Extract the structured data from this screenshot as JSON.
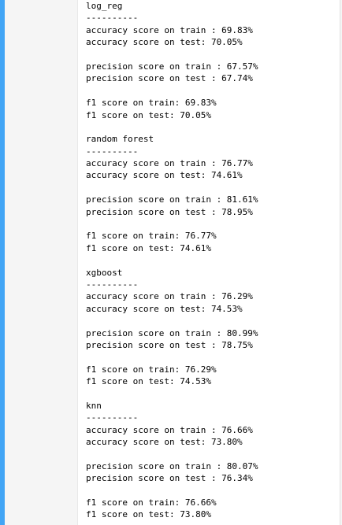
{
  "output": {
    "models": [
      {
        "name": "log_reg",
        "separator": "----------",
        "accuracy_train": "accuracy score on train : 69.83%",
        "accuracy_test": "accuracy score on test: 70.05%",
        "precision_train": "precision score on train : 67.57%",
        "precision_test": "precision score on test : 67.74%",
        "f1_train": "f1 score on train: 69.83%",
        "f1_test": "f1 score on test: 70.05%"
      },
      {
        "name": "random forest",
        "separator": "----------",
        "accuracy_train": "accuracy score on train : 76.77%",
        "accuracy_test": "accuracy score on test: 74.61%",
        "precision_train": "precision score on train : 81.61%",
        "precision_test": "precision score on test : 78.95%",
        "f1_train": "f1 score on train: 76.77%",
        "f1_test": "f1 score on test: 74.61%"
      },
      {
        "name": "xgboost",
        "separator": "----------",
        "accuracy_train": "accuracy score on train : 76.29%",
        "accuracy_test": "accuracy score on test: 74.53%",
        "precision_train": "precision score on train : 80.99%",
        "precision_test": "precision score on test : 78.75%",
        "f1_train": "f1 score on train: 76.29%",
        "f1_test": "f1 score on test: 74.53%"
      },
      {
        "name": "knn",
        "separator": "----------",
        "accuracy_train": "accuracy score on train : 76.66%",
        "accuracy_test": "accuracy score on test: 73.80%",
        "precision_train": "precision score on train : 80.07%",
        "precision_test": "precision score on test : 76.34%",
        "f1_train": "f1 score on train: 76.66%",
        "f1_test": "f1 score on test: 73.80%"
      }
    ]
  }
}
